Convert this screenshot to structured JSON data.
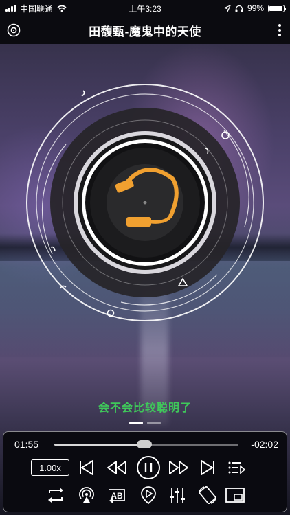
{
  "status": {
    "carrier": "中国联通",
    "time": "上午3:23",
    "battery": "99%"
  },
  "header": {
    "title": "田馥甄-魔鬼中的天使"
  },
  "lyric": {
    "current_line": "会不会比较聪明了"
  },
  "player": {
    "elapsed": "01:55",
    "remaining": "-02:02",
    "progress_fraction": 0.49,
    "speed_label": "1.00x"
  },
  "pager": {
    "pages": 2,
    "active": 0
  },
  "colors": {
    "lyric": "#3fc85a",
    "headphone": "#f0a030",
    "panel_bg": "#0a0a10"
  },
  "icons": {
    "header": [
      "disc-icon",
      "more-vertical-icon"
    ],
    "row1": [
      "previous-track-icon",
      "rewind-icon",
      "pause-icon",
      "fast-forward-icon",
      "next-track-icon",
      "playlist-icon"
    ],
    "row2": [
      "repeat-icon",
      "airplay-icon",
      "ab-loop-icon",
      "play-marker-icon",
      "equalizer-icon",
      "rotate-screen-icon",
      "picture-in-picture-icon"
    ]
  }
}
